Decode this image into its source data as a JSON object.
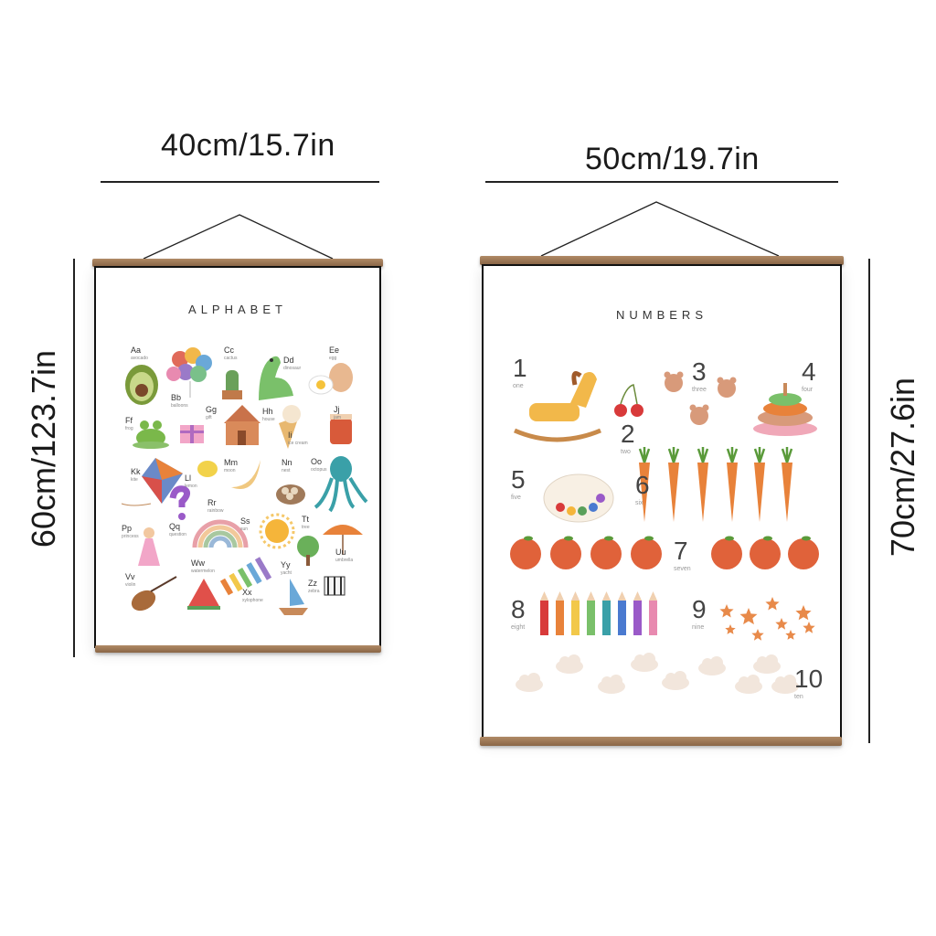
{
  "dimensions": {
    "left_width": "40cm/15.7in",
    "left_height": "60cm/123.7in",
    "right_width": "50cm/19.7in",
    "right_height": "70cm/27.6in"
  },
  "alphabet_poster": {
    "title": "ALPHABET",
    "letters": [
      {
        "letter": "Aa",
        "word": "avocado"
      },
      {
        "letter": "Bb",
        "word": "balloons"
      },
      {
        "letter": "Cc",
        "word": "cactus"
      },
      {
        "letter": "Dd",
        "word": "dinosaur"
      },
      {
        "letter": "Ee",
        "word": "egg"
      },
      {
        "letter": "Ff",
        "word": "frog"
      },
      {
        "letter": "Gg",
        "word": "gift"
      },
      {
        "letter": "Hh",
        "word": "house"
      },
      {
        "letter": "Ii",
        "word": "ice cream"
      },
      {
        "letter": "Jj",
        "word": "jam"
      },
      {
        "letter": "Kk",
        "word": "kite"
      },
      {
        "letter": "Ll",
        "word": "lemon"
      },
      {
        "letter": "Mm",
        "word": "moon"
      },
      {
        "letter": "Nn",
        "word": "nest"
      },
      {
        "letter": "Oo",
        "word": "octopus"
      },
      {
        "letter": "Pp",
        "word": "princess"
      },
      {
        "letter": "Qq",
        "word": "question"
      },
      {
        "letter": "Rr",
        "word": "rainbow"
      },
      {
        "letter": "Ss",
        "word": "sun"
      },
      {
        "letter": "Tt",
        "word": "tree"
      },
      {
        "letter": "Uu",
        "word": "umbrella"
      },
      {
        "letter": "Vv",
        "word": "violin"
      },
      {
        "letter": "Ww",
        "word": "watermelon"
      },
      {
        "letter": "Xx",
        "word": "xylophone"
      },
      {
        "letter": "Yy",
        "word": "yacht"
      },
      {
        "letter": "Zz",
        "word": "zebra"
      }
    ]
  },
  "numbers_poster": {
    "title": "NUMBERS",
    "numbers": [
      {
        "n": "1",
        "word": "one"
      },
      {
        "n": "2",
        "word": "two"
      },
      {
        "n": "3",
        "word": "three"
      },
      {
        "n": "4",
        "word": "four"
      },
      {
        "n": "5",
        "word": "five"
      },
      {
        "n": "6",
        "word": "six"
      },
      {
        "n": "7",
        "word": "seven"
      },
      {
        "n": "8",
        "word": "eight"
      },
      {
        "n": "9",
        "word": "nine"
      },
      {
        "n": "10",
        "word": "ten"
      }
    ]
  },
  "colors": {
    "rod": "#9a7453",
    "frame_border": "#111111",
    "carrot": "#e8823a",
    "orange": "#e0623a",
    "star": "#e88a4a"
  }
}
